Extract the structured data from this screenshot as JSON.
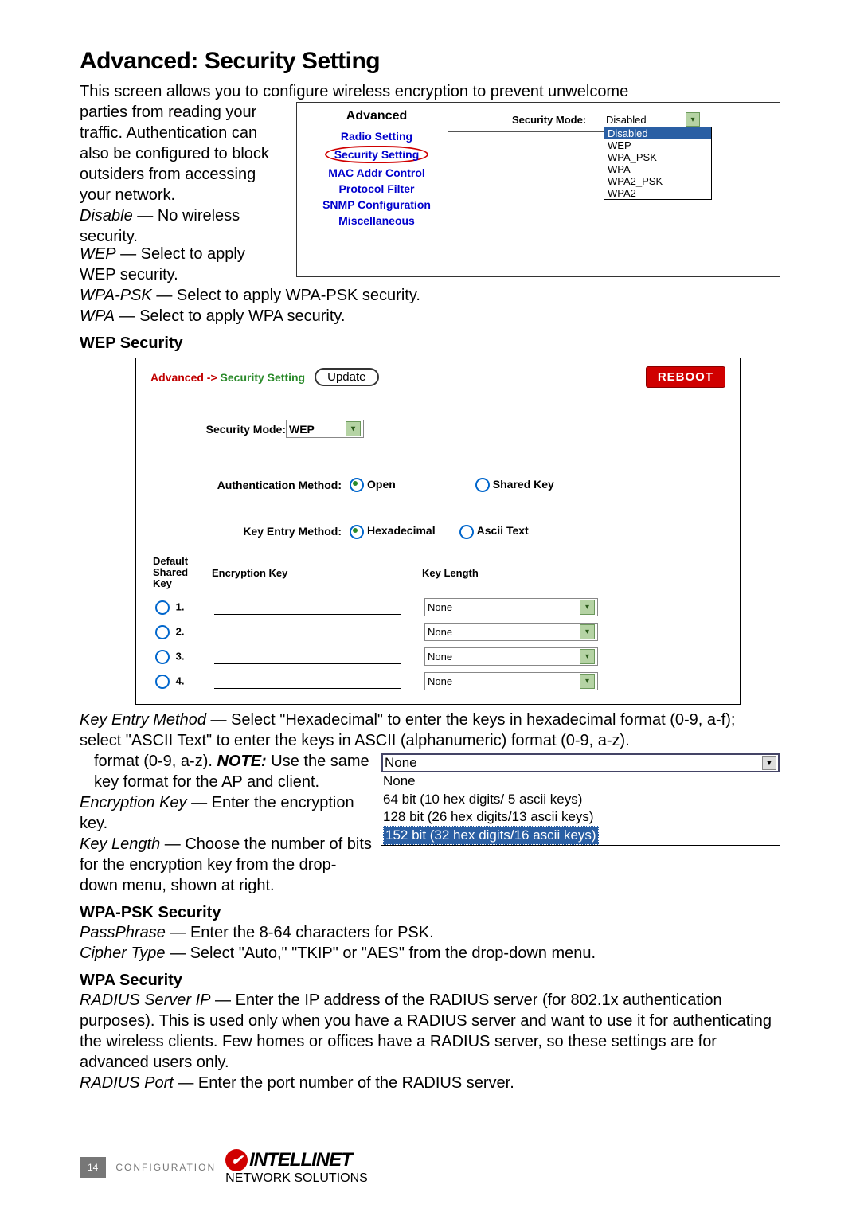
{
  "title": "Advanced: Security Setting",
  "intro_top": "This screen allows you to configure wireless encryption to prevent unwelcome",
  "intro_left": "parties from reading your traffic. Authentication can also be configured to block outsiders from accessing your network.",
  "modes": {
    "disable_label": "Disable",
    "disable_text": " — No wireless security.",
    "wep_label": "WEP",
    "wep_text": " — Select to apply WEP security.",
    "wpapsk_label": "WPA-PSK",
    "wpapsk_text": " — Select to apply WPA-PSK security.",
    "wpa_label": "WPA",
    "wpa_text": " — Select to apply WPA security."
  },
  "adv_menu": {
    "title": "Advanced",
    "items": [
      "Radio Setting",
      "Security Setting",
      "MAC Addr Control",
      "Protocol Filter",
      "SNMP Configuration",
      "Miscellaneous"
    ]
  },
  "sec_mode": {
    "label": "Security Mode:",
    "selected": "Disabled",
    "options": [
      "Disabled",
      "WEP",
      "WPA_PSK",
      "WPA",
      "WPA2_PSK",
      "WPA2"
    ]
  },
  "wep": {
    "heading": "WEP Security",
    "breadcrumb_a": "Advanced ->",
    "breadcrumb_b": "Security Setting",
    "update": "Update",
    "reboot": "REBOOT",
    "sm_label": "Security Mode:",
    "sm_value": "WEP",
    "auth_label": "Authentication Method:",
    "auth_open": "Open",
    "auth_shared": "Shared Key",
    "kem_label": "Key Entry Method:",
    "kem_hex": "Hexadecimal",
    "kem_ascii": "Ascii Text",
    "col_default": "Default Shared Key",
    "col_enc": "Encryption Key",
    "col_len": "Key Length",
    "rows": [
      "1.",
      "2.",
      "3.",
      "4."
    ],
    "none": "None"
  },
  "kem_desc": {
    "p1a": "Key Entry Method",
    "p1b": " — Select \"Hexadecimal\" to enter the keys in hexadecimal format (0-9, a-f); select \"ASCII Text\" to enter the keys in ASCII (alphanumeric) format (0-9, a-z). ",
    "p1note": "NOTE:",
    "p1c": " Use the same key format for the AP and client.",
    "p2a": "Encryption Key",
    "p2b": " — Enter the encryption key.",
    "p3a": "Key Length",
    "p3b": " — Choose the number of bits for the encryption key from the drop-down menu, shown at right."
  },
  "kl_drop": {
    "top": "None",
    "opts": [
      "None",
      "64 bit (10 hex digits/ 5 ascii keys)",
      "128 bit (26 hex digits/13 ascii keys)",
      "152 bit (32 hex digits/16 ascii keys)"
    ]
  },
  "wpapsk": {
    "heading": "WPA-PSK Security",
    "l1a": "PassPhrase",
    "l1b": " — Enter the 8-64 characters for PSK.",
    "l2a": "Cipher Type",
    "l2b": " — Select \"Auto,\" \"TKIP\" or \"AES\" from the drop-down menu."
  },
  "wpa": {
    "heading": "WPA Security",
    "l1a": "RADIUS Server IP",
    "l1b": " — Enter the IP address of the RADIUS server (for 802.1x authentication purposes). This is used only when you have a RADIUS server and want to use it for authenticating the wireless clients. Few homes or offices have a RADIUS server, so these settings are for  advanced users only.",
    "l2a": "RADIUS Port",
    "l2b": " — Enter the port number of the RADIUS server."
  },
  "footer": {
    "page": "14",
    "section": "CONFIGURATION",
    "brand": "INTELLINET",
    "brand_sub": "NETWORK SOLUTIONS"
  }
}
